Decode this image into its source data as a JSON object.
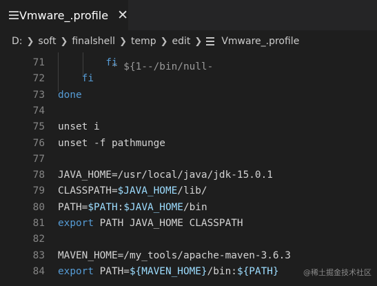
{
  "tab": {
    "title": "Vmware_.profile",
    "icon": "lines-file-icon",
    "close_glyph": "✕"
  },
  "breadcrumb": {
    "items": [
      "D:",
      "soft",
      "finalshell",
      "temp",
      "edit"
    ],
    "file": "Vmware_.profile"
  },
  "code": {
    "partial_first_line": "         * ${1--/bin/null-",
    "lines": [
      {
        "n": "71",
        "segments": [
          {
            "t": "        ",
            "c": "plain"
          },
          {
            "t": "fi",
            "c": "kw"
          }
        ]
      },
      {
        "n": "72",
        "segments": [
          {
            "t": "    ",
            "c": "plain"
          },
          {
            "t": "fi",
            "c": "kw"
          }
        ]
      },
      {
        "n": "73",
        "segments": [
          {
            "t": "done",
            "c": "kw"
          }
        ]
      },
      {
        "n": "74",
        "segments": []
      },
      {
        "n": "75",
        "segments": [
          {
            "t": "unset i",
            "c": "plain"
          }
        ]
      },
      {
        "n": "76",
        "segments": [
          {
            "t": "unset -f pathmunge",
            "c": "plain"
          }
        ]
      },
      {
        "n": "77",
        "segments": []
      },
      {
        "n": "78",
        "segments": [
          {
            "t": "JAVA_HOME=/usr/local/java/jdk-15.0.1",
            "c": "plain"
          }
        ]
      },
      {
        "n": "79",
        "segments": [
          {
            "t": "CLASSPATH=",
            "c": "plain"
          },
          {
            "t": "$JAVA_HOME",
            "c": "var"
          },
          {
            "t": "/lib/",
            "c": "plain"
          }
        ]
      },
      {
        "n": "80",
        "segments": [
          {
            "t": "PATH=",
            "c": "plain"
          },
          {
            "t": "$PATH",
            "c": "var"
          },
          {
            "t": ":",
            "c": "plain"
          },
          {
            "t": "$JAVA_HOME",
            "c": "var"
          },
          {
            "t": "/bin",
            "c": "plain"
          }
        ]
      },
      {
        "n": "81",
        "segments": [
          {
            "t": "export",
            "c": "kw"
          },
          {
            "t": " PATH JAVA_HOME CLASSPATH",
            "c": "plain"
          }
        ]
      },
      {
        "n": "82",
        "segments": []
      },
      {
        "n": "83",
        "segments": [
          {
            "t": "MAVEN_HOME=/my_tools/apache-maven-3.6.3",
            "c": "plain"
          }
        ]
      },
      {
        "n": "84",
        "segments": [
          {
            "t": "export",
            "c": "kw"
          },
          {
            "t": " PATH=",
            "c": "plain"
          },
          {
            "t": "${MAVEN_HOME}",
            "c": "var"
          },
          {
            "t": "/bin:",
            "c": "plain"
          },
          {
            "t": "${PATH}",
            "c": "var"
          }
        ]
      }
    ]
  },
  "watermark": "@稀土掘金技术社区",
  "colors": {
    "background": "#1e1e1e",
    "keyword": "#569cd6",
    "variable": "#9cdcfe",
    "text": "#d4d4d4",
    "line_number": "#858585"
  }
}
